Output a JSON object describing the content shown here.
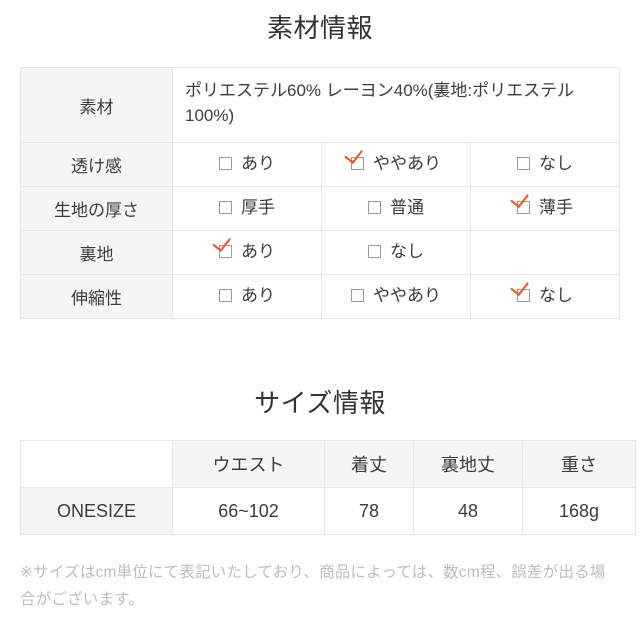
{
  "material_section": {
    "heading": "素材情報",
    "rows": [
      {
        "label": "素材",
        "type": "text",
        "value": "ポリエステル60% レーヨン40%(裏地:ポリエステル100%)",
        "value_color": "#fb4d92"
      },
      {
        "label": "透け感",
        "type": "options",
        "options": [
          {
            "label": "あり",
            "checked": false
          },
          {
            "label": "ややあり",
            "checked": true
          },
          {
            "label": "なし",
            "checked": false
          }
        ]
      },
      {
        "label": "生地の厚さ",
        "type": "options",
        "options": [
          {
            "label": "厚手",
            "checked": false
          },
          {
            "label": "普通",
            "checked": false
          },
          {
            "label": "薄手",
            "checked": true
          }
        ]
      },
      {
        "label": "裏地",
        "type": "options",
        "options": [
          {
            "label": "あり",
            "checked": true
          },
          {
            "label": "なし",
            "checked": false
          },
          {
            "label": "",
            "checked": false,
            "empty": true
          }
        ]
      },
      {
        "label": "伸縮性",
        "type": "options",
        "options": [
          {
            "label": "あり",
            "checked": false
          },
          {
            "label": "ややあり",
            "checked": false
          },
          {
            "label": "なし",
            "checked": true
          }
        ]
      }
    ]
  },
  "size_section": {
    "heading": "サイズ情報",
    "columns": [
      "",
      "ウエスト",
      "着丈",
      "裏地丈",
      "重さ"
    ],
    "rows": [
      {
        "label": "ONESIZE",
        "values": [
          "66~102",
          "78",
          "48",
          "168g"
        ]
      }
    ],
    "note": "※サイズはcm単位にて表記いたしており、商品によっては、数cm程、誤差が出る場合がございます。"
  },
  "icons": {
    "checkbox_unchecked": "checkbox-unchecked-icon",
    "checkbox_checked": "checkbox-checked-icon"
  },
  "colors": {
    "composition_pink": "#fb4d92",
    "check_orange": "#f4531f",
    "header_gray": "#f5f5f5",
    "border_gray": "#e6e6e6",
    "note_gray": "#bdbdbd"
  }
}
